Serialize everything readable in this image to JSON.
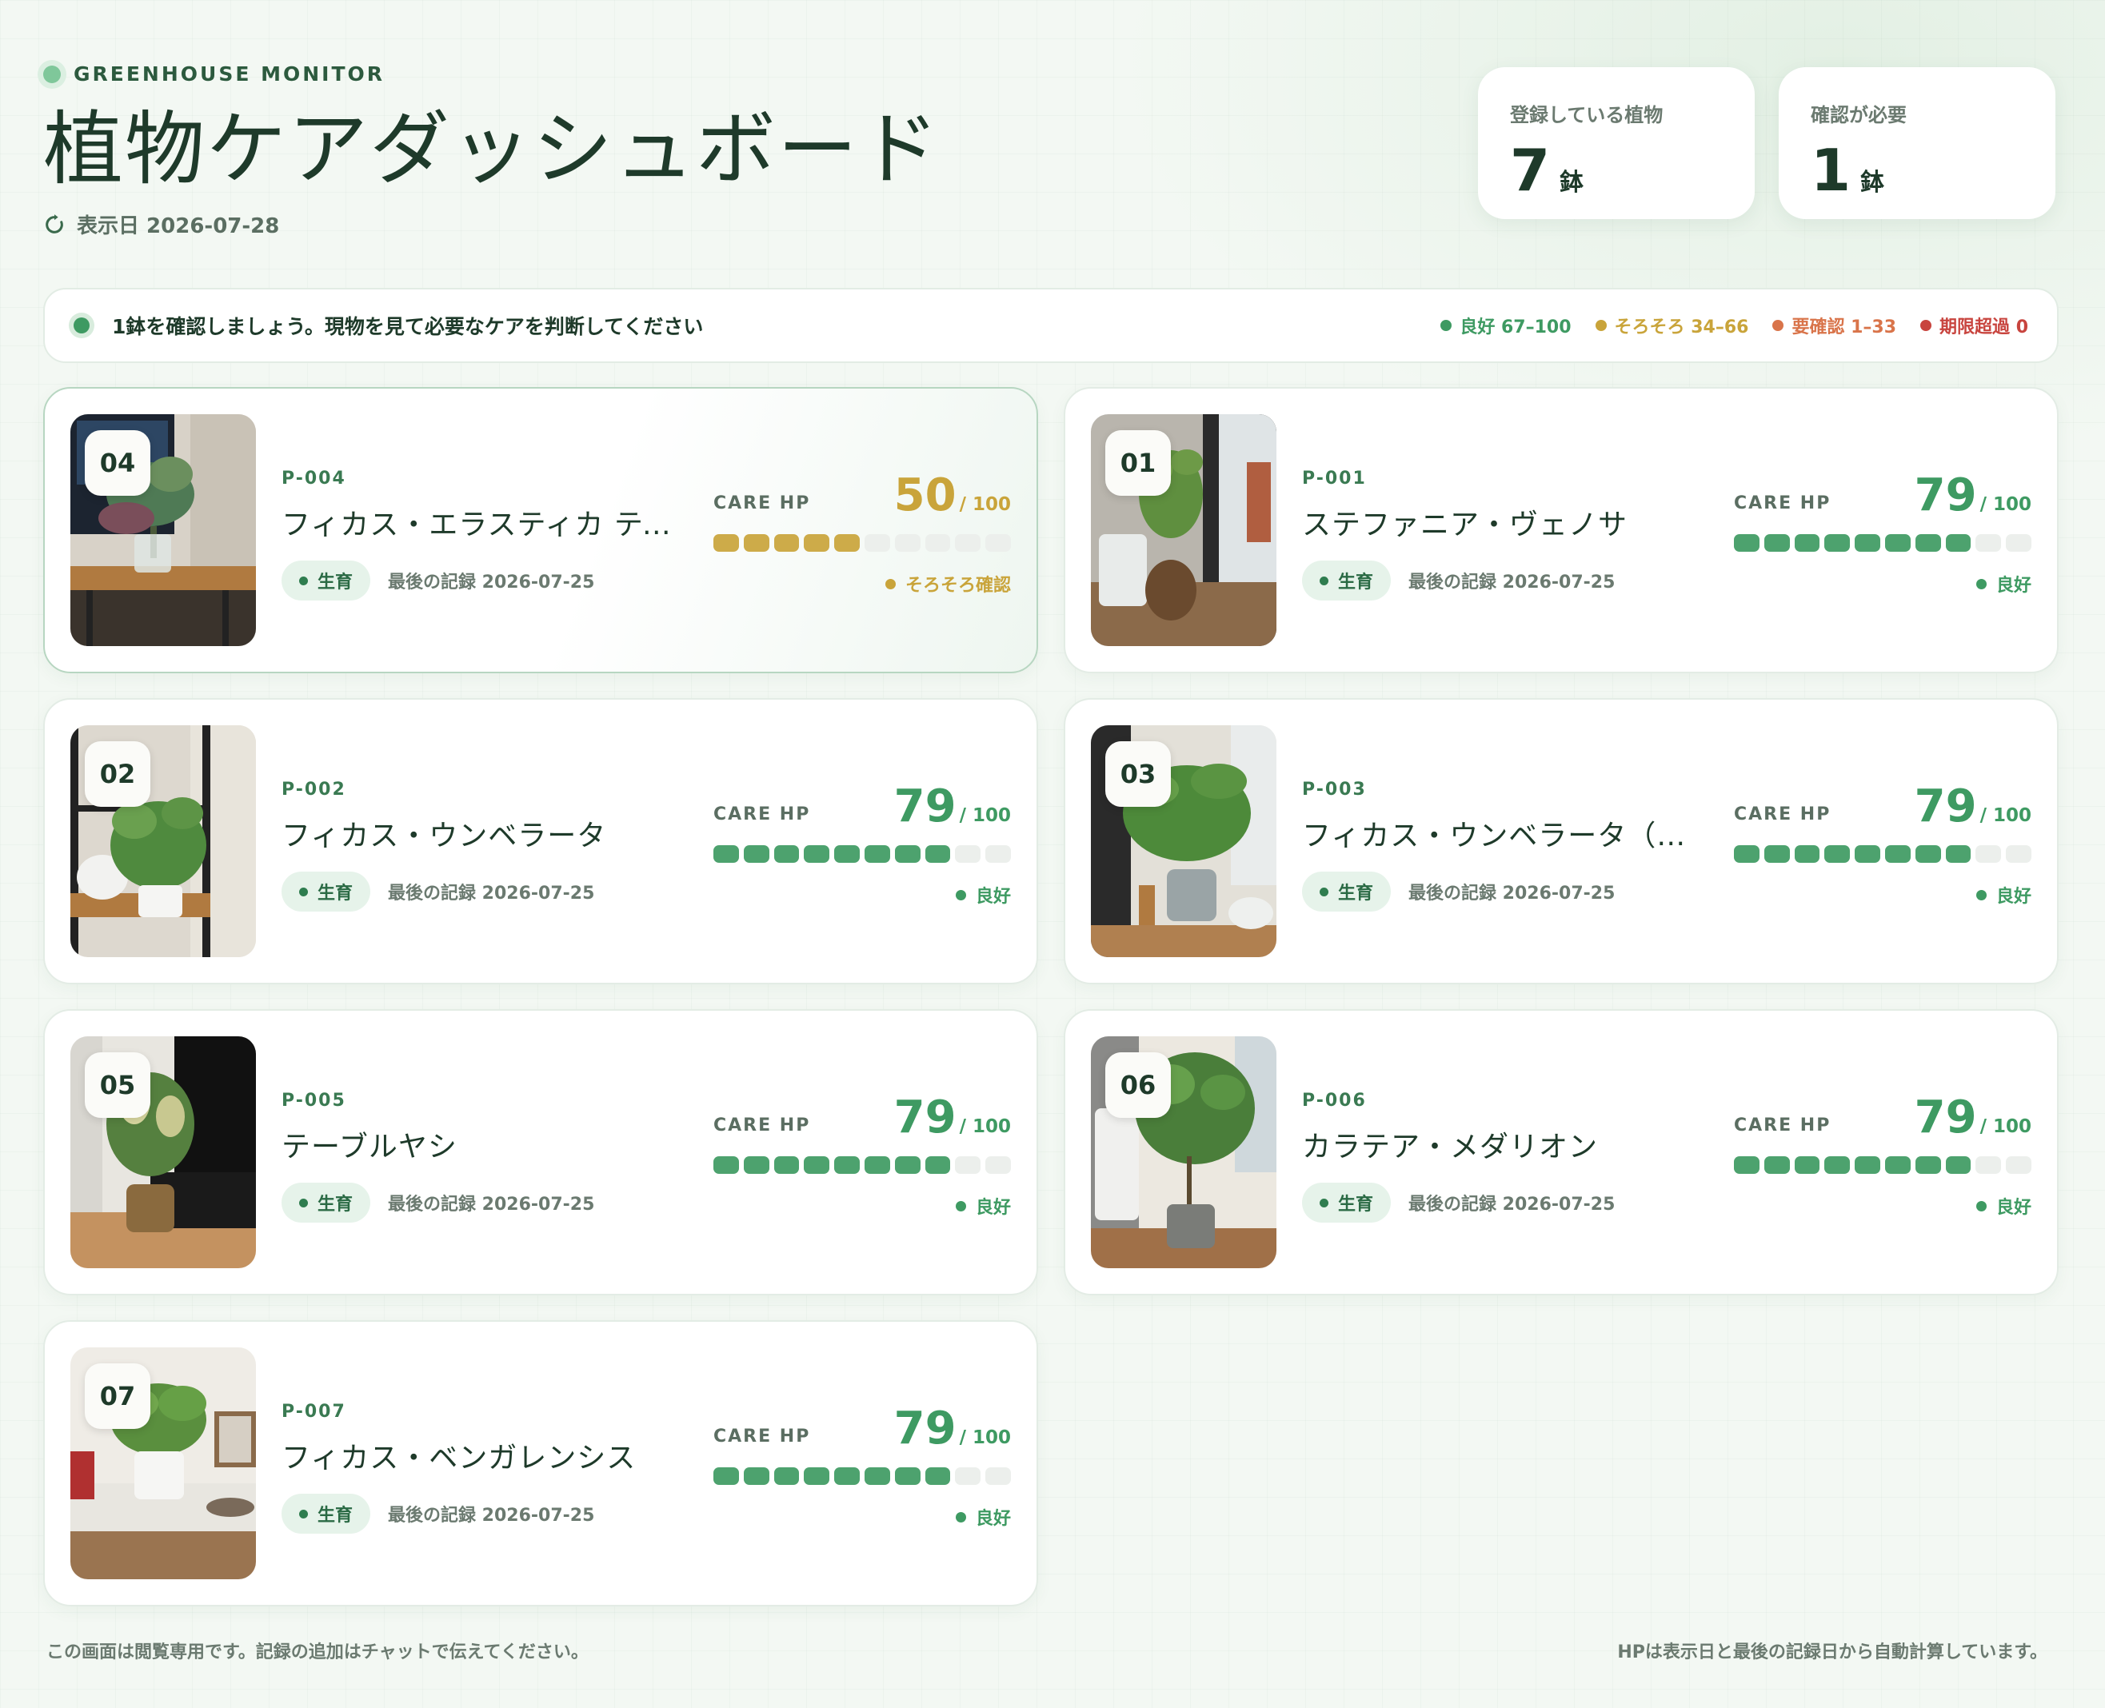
{
  "header": {
    "eyebrow": "GREENHOUSE MONITOR",
    "title": "植物ケアダッシュボード",
    "display_date": "表示日 2026-07-28"
  },
  "stats": [
    {
      "label": "登録している植物",
      "value": "7",
      "unit": "鉢"
    },
    {
      "label": "確認が必要",
      "value": "1",
      "unit": "鉢"
    }
  ],
  "notice": {
    "text": "1鉢を確認しましょう。現物を見て必要なケアを判断してください",
    "legend": [
      {
        "label": "良好 67–100",
        "color": "#3e9a62"
      },
      {
        "label": "そろそろ 34–66",
        "color": "#c9a43a"
      },
      {
        "label": "要確認 1–33",
        "color": "#d9744a"
      },
      {
        "label": "期限超過 0",
        "color": "#c8443e"
      }
    ]
  },
  "care_hp_label": "CARE HP",
  "hp_max": "/ 100",
  "plants": [
    {
      "badge": "04",
      "id": "P-004",
      "name": "フィカス・エラスティカ ティ…",
      "status": "生育",
      "last_log": "最後の記録 2026-07-25",
      "hp": "50",
      "hp_fraction": 0.5,
      "hp_status": "そろそろ確認",
      "color": "#c9a43a",
      "highlight": true,
      "photo": "photo-04"
    },
    {
      "badge": "01",
      "id": "P-001",
      "name": "ステファニア・ヴェノサ",
      "status": "生育",
      "last_log": "最後の記録 2026-07-25",
      "hp": "79",
      "hp_fraction": 0.79,
      "hp_status": "良好",
      "color": "#3e9a62",
      "highlight": false,
      "photo": "photo-01"
    },
    {
      "badge": "02",
      "id": "P-002",
      "name": "フィカス・ウンベラータ",
      "status": "生育",
      "last_log": "最後の記録 2026-07-25",
      "hp": "79",
      "hp_fraction": 0.79,
      "hp_status": "良好",
      "color": "#3e9a62",
      "highlight": false,
      "photo": "photo-02"
    },
    {
      "badge": "03",
      "id": "P-003",
      "name": "フィカス・ウンベラータ（株…",
      "status": "生育",
      "last_log": "最後の記録 2026-07-25",
      "hp": "79",
      "hp_fraction": 0.79,
      "hp_status": "良好",
      "color": "#3e9a62",
      "highlight": false,
      "photo": "photo-03"
    },
    {
      "badge": "05",
      "id": "P-005",
      "name": "テーブルヤシ",
      "status": "生育",
      "last_log": "最後の記録 2026-07-25",
      "hp": "79",
      "hp_fraction": 0.79,
      "hp_status": "良好",
      "color": "#3e9a62",
      "highlight": false,
      "photo": "photo-05"
    },
    {
      "badge": "06",
      "id": "P-006",
      "name": "カラテア・メダリオン",
      "status": "生育",
      "last_log": "最後の記録 2026-07-25",
      "hp": "79",
      "hp_fraction": 0.79,
      "hp_status": "良好",
      "color": "#3e9a62",
      "highlight": false,
      "photo": "photo-06"
    },
    {
      "badge": "07",
      "id": "P-007",
      "name": "フィカス・ベンガレンシス",
      "status": "生育",
      "last_log": "最後の記録 2026-07-25",
      "hp": "79",
      "hp_fraction": 0.79,
      "hp_status": "良好",
      "color": "#3e9a62",
      "highlight": false,
      "photo": "photo-07"
    }
  ],
  "footer": {
    "left": "この画面は閲覧専用です。記録の追加はチャットで伝えてください。",
    "right": "HPは表示日と最後の記録日から自動計算しています。"
  }
}
